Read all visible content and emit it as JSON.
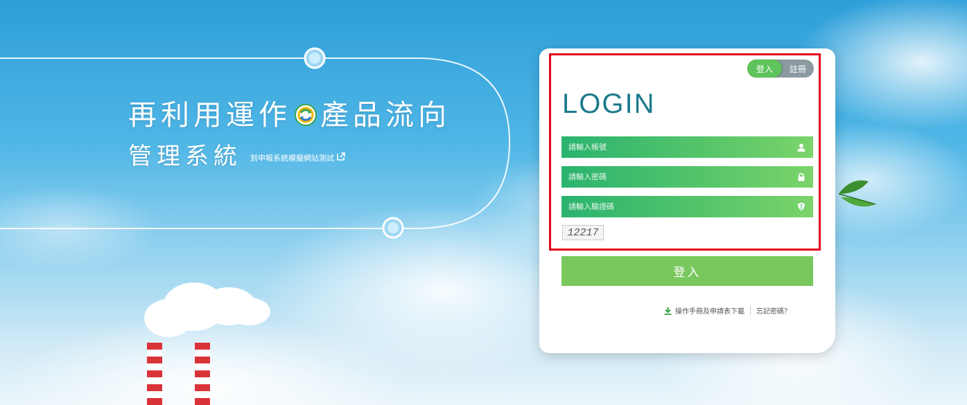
{
  "title": {
    "main_before": "再利用運作",
    "main_after": "產品流向",
    "sub": "管理系統",
    "test_link": "到申報系統模擬網站測試"
  },
  "tabs": {
    "login": "登入",
    "register": "註冊"
  },
  "login": {
    "heading": "LOGIN",
    "account_placeholder": "請輸入帳號",
    "password_placeholder": "請輸入密碼",
    "captcha_placeholder": "請輸入驗證碼",
    "captcha_code": "12217",
    "submit_label": "登入"
  },
  "footer": {
    "download_label": "操作手冊及申請表下載",
    "forgot_label": "忘記密碼？"
  },
  "colors": {
    "accent_green": "#5ec35a",
    "heading_teal": "#1b7a8c",
    "highlight_red": "#e2001a"
  },
  "icons": [
    "recycle-icon",
    "external-link-icon",
    "user-icon",
    "lock-icon",
    "shield-icon",
    "download-icon"
  ]
}
